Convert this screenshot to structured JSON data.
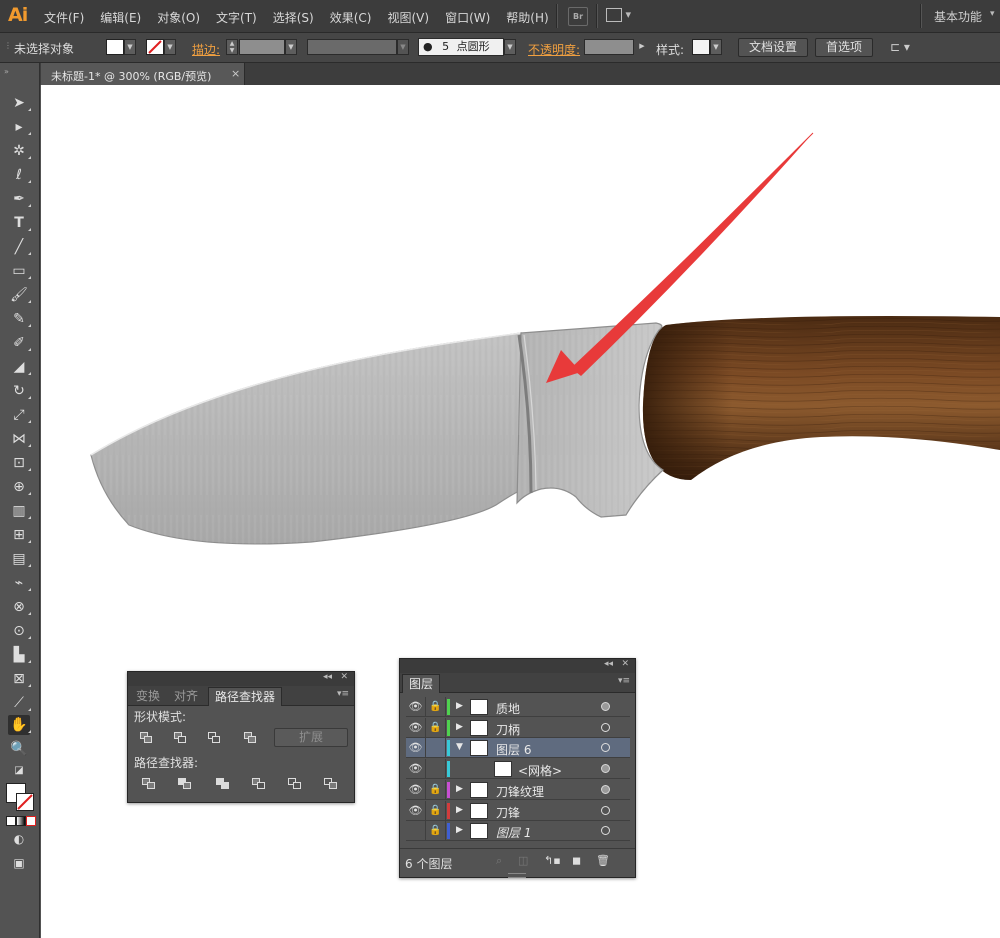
{
  "app": {
    "logo": "Ai"
  },
  "menu": [
    "文件(F)",
    "编辑(E)",
    "对象(O)",
    "文字(T)",
    "选择(S)",
    "效果(C)",
    "视图(V)",
    "窗口(W)",
    "帮助(H)"
  ],
  "bridge_label": "Br",
  "workspace": "基本功能",
  "control": {
    "selection": "未选择对象",
    "stroke_label": "描边:",
    "brush_size": "5",
    "brush_shape": "点圆形",
    "opacity_label": "不透明度:",
    "style_label": "样式:",
    "doc_setup": "文档设置",
    "preferences": "首选项"
  },
  "doc_tab": {
    "title": "未标题-1* @ 300% (RGB/预览)",
    "close": "×"
  },
  "pathfinder": {
    "tabs": [
      "变换",
      "对齐",
      "路径查找器"
    ],
    "active_tab": 2,
    "shape_modes": "形状模式:",
    "pathfinders": "路径查找器:",
    "expand": "扩展"
  },
  "layers": {
    "tab": "图层",
    "rows": [
      {
        "name": "质地",
        "color": "#4fd24f",
        "lock": true,
        "expanded": false,
        "selected": false,
        "filled_target": true
      },
      {
        "name": "刀柄",
        "color": "#4fd24f",
        "lock": true,
        "expanded": false,
        "selected": false,
        "filled_target": false
      },
      {
        "name": "图层 6",
        "color": "#38c9d8",
        "lock": false,
        "expanded": true,
        "selected": true,
        "filled_target": false
      },
      {
        "name": "<网格>",
        "color": "#38c9d8",
        "lock": false,
        "expanded": false,
        "selected": false,
        "filled_target": true,
        "sublayer": true
      },
      {
        "name": "刀锋纹理",
        "color": "#c84fd2",
        "lock": true,
        "expanded": false,
        "selected": false,
        "filled_target": true
      },
      {
        "name": "刀锋",
        "color": "#d23c3c",
        "lock": true,
        "expanded": false,
        "selected": false,
        "filled_target": false
      },
      {
        "name": "图层 1",
        "color": "#3f5fd2",
        "lock": true,
        "expanded": false,
        "selected": false,
        "filled_target": false,
        "italic": true,
        "no_eye": true
      }
    ],
    "footer": "6 个图层"
  },
  "colors": {
    "accent_orange": "#f1a040",
    "annotation_arrow": "#e83a3a",
    "handle_wood": "#6b3f1e",
    "blade_gray": "#b9b9b9"
  }
}
